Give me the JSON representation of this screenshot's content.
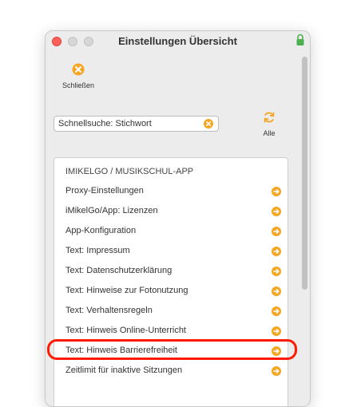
{
  "window": {
    "title": "Einstellungen Übersicht"
  },
  "toolbar": {
    "close_label": "Schließen"
  },
  "search": {
    "value": "Schnellsuche: Stichwort"
  },
  "alle": {
    "label": "Alle"
  },
  "list": {
    "header": "IMIKELGO / MUSIKSCHUL-APP",
    "items": [
      {
        "label": "Proxy-Einstellungen"
      },
      {
        "label": "iMikelGo/App: Lizenzen"
      },
      {
        "label": "App-Konfiguration"
      },
      {
        "label": "Text: Impressum"
      },
      {
        "label": "Text: Datenschutzerklärung"
      },
      {
        "label": "Text: Hinweise zur Fotonutzung"
      },
      {
        "label": "Text: Verhaltensregeln"
      },
      {
        "label": "Text: Hinweis Online-Unterricht"
      },
      {
        "label": "Text: Hinweis Barrierefreiheit"
      },
      {
        "label": "Zeitlimit für inaktive Sitzungen"
      }
    ]
  },
  "colors": {
    "accent": "#f5a623",
    "highlight": "#ff1a00",
    "lock": "#4caf50"
  }
}
